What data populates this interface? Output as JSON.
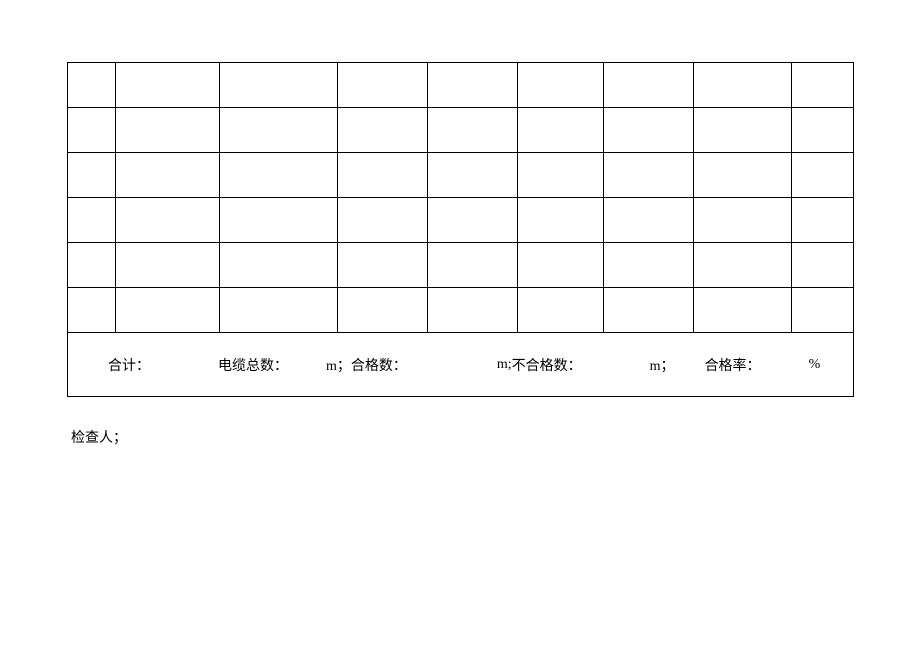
{
  "summary": {
    "total_label": "合计：",
    "cable_total_label": "电缆总数：",
    "cable_total_unit": "m；",
    "qualified_label": "合格数：",
    "qualified_unit": "m;",
    "unqualified_label": "不合格数：",
    "unqualified_unit": "m；",
    "rate_label": "合格率：",
    "rate_unit": "%"
  },
  "footer": {
    "inspector_label": "检查人；"
  }
}
